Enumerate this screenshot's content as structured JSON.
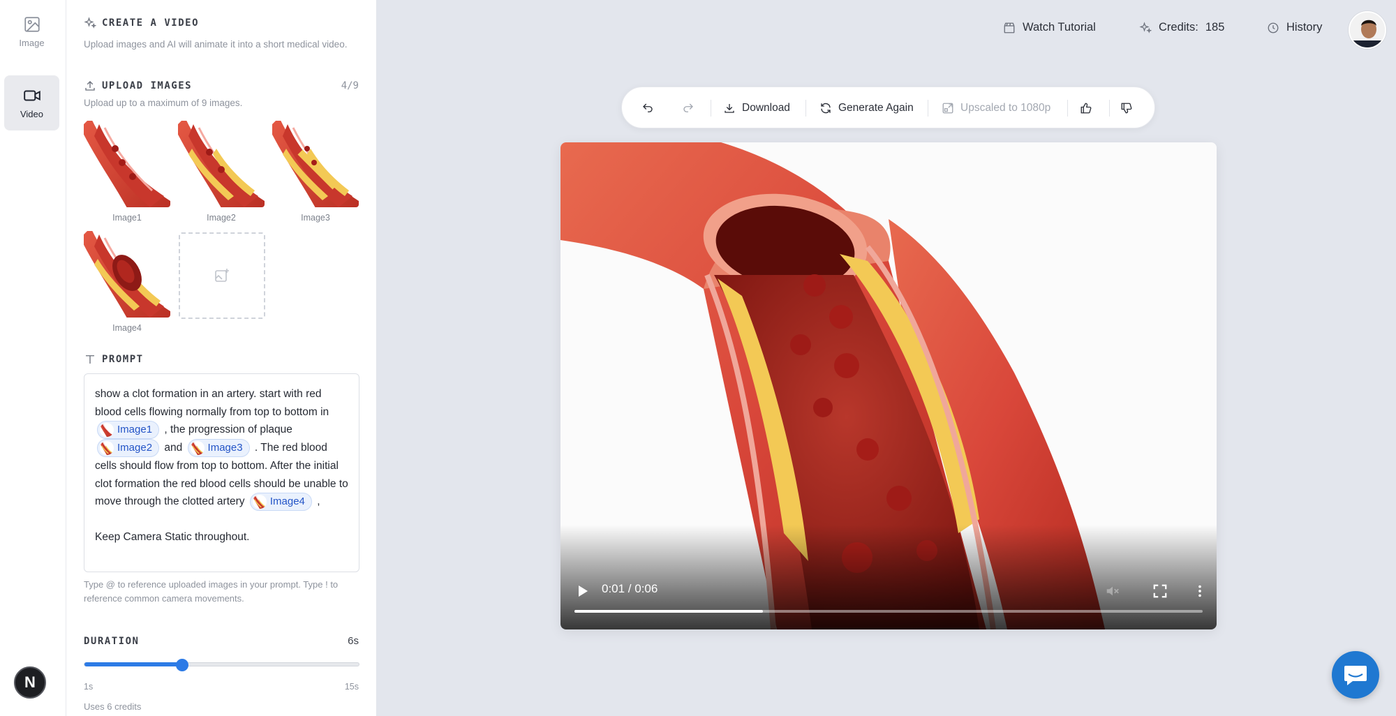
{
  "rail": {
    "items": [
      {
        "label": "Image",
        "icon": "image-icon"
      },
      {
        "label": "Video",
        "icon": "video-camera-icon",
        "active": true
      }
    ],
    "logo_letter": "N"
  },
  "panel": {
    "create": {
      "title": "CREATE A VIDEO",
      "subtitle": "Upload images and AI will animate it into a short medical video."
    },
    "upload": {
      "title": "UPLOAD IMAGES",
      "counter": "4/9",
      "subtitle": "Upload up to a maximum of 9 images.",
      "images": [
        {
          "label": "Image1"
        },
        {
          "label": "Image2"
        },
        {
          "label": "Image3"
        },
        {
          "label": "Image4"
        }
      ]
    },
    "prompt": {
      "title": "PROMPT",
      "text_1": "show a clot formation in an artery. start with red blood cells flowing normally from top to bottom in",
      "chip_1": "Image1",
      "text_2": ", the progression of plaque",
      "chip_2": "Image2",
      "text_3": "and",
      "chip_3": "Image3",
      "text_4": ". The red blood cells should flow from top to bottom. After the initial clot formation the red blood cells should be unable to move through the clotted artery",
      "chip_4": "Image4",
      "text_5": ",",
      "text_6": "Keep Camera Static throughout.",
      "hint": "Type @ to reference uploaded images in your prompt. Type ! to reference common camera movements."
    },
    "duration": {
      "title": "DURATION",
      "value_label": "6s",
      "value": 6,
      "min": 1,
      "max": 15,
      "min_label": "1s",
      "max_label": "15s",
      "credits_note": "Uses 6 credits"
    }
  },
  "topnav": {
    "tutorial": "Watch Tutorial",
    "credits_label": "Credits:",
    "credits_value": "185",
    "history": "History"
  },
  "toolbar": {
    "download": "Download",
    "generate_again": "Generate Again",
    "upscaled": "Upscaled to 1080p"
  },
  "video": {
    "time": "0:01 / 0:06",
    "progress": 0.3
  },
  "colors": {
    "accent": "#2d7be6",
    "chip_text": "#2455c7",
    "chat_button": "#1f78d1",
    "artery_red": "#d9473a",
    "plaque_yellow": "#f3c955"
  }
}
